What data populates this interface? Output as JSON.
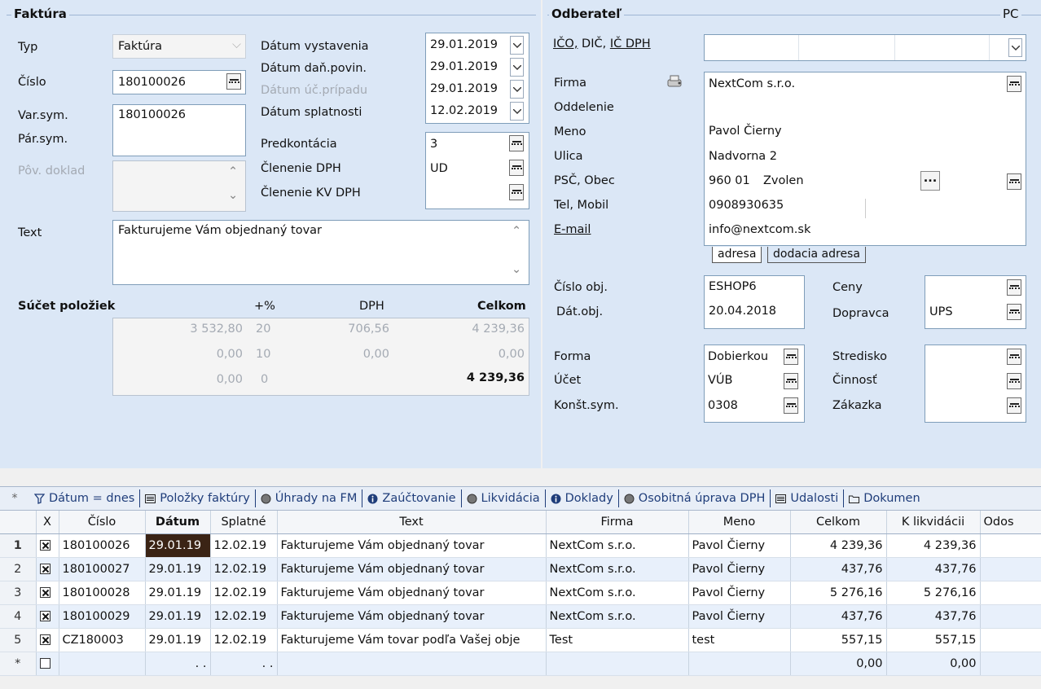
{
  "faktura": {
    "section_title": "Faktúra",
    "typ_label": "Typ",
    "typ_value": "Faktúra",
    "cislo_label": "Číslo",
    "cislo_value": "180100026",
    "varsym_label": "Var.sym.",
    "varsym_value": "180100026",
    "parsym_label": "Pár.sym.",
    "povdoklad_label": "Pôv. doklad",
    "text_label": "Text",
    "text_value": "Fakturujeme Vám objednaný tovar",
    "dates": [
      {
        "label": "Dátum vystavenia",
        "value": "29.01.2019"
      },
      {
        "label": "Dátum daň.povin.",
        "value": "29.01.2019"
      },
      {
        "label": "Dátum úč.prípadu",
        "value": "29.01.2019"
      },
      {
        "label": "Dátum splatnosti",
        "value": "12.02.2019"
      }
    ],
    "predkontacia_label": "Predkontácia",
    "predkontacia_value": "3",
    "clenenie_dph_label": "Členenie DPH",
    "clenenie_dph_value": "UD",
    "clenenie_kv_label": "Členenie KV DPH",
    "sucet": {
      "title": "Súčet položiek",
      "col_pct": "+%",
      "col_dph": "DPH",
      "col_celkom": "Celkom",
      "rows": [
        {
          "base": "3 532,80",
          "pct": "20",
          "dph": "706,56",
          "celkom": "4 239,36"
        },
        {
          "base": "0,00",
          "pct": "10",
          "dph": "0,00",
          "celkom": "0,00"
        },
        {
          "base": "0,00",
          "pct": "0",
          "dph": "",
          "celkom": "4 239,36"
        }
      ]
    }
  },
  "odberatel": {
    "section_title": "Odberateľ",
    "pc_label": "PC",
    "ico_label": "IČO,",
    "dic_label": "DIČ,",
    "icdph_label": "IČ DPH",
    "firma_label": "Firma",
    "firma_value": "NextCom s.r.o.",
    "oddelenie_label": "Oddelenie",
    "meno_label": "Meno",
    "meno_value": "Pavol Čierny",
    "ulica_label": "Ulica",
    "ulica_value": "Nadvorna 2",
    "psc_label": "PSČ, Obec",
    "psc_value": "960 01",
    "obec_value": "Zvolen",
    "tel_label": "Tel, Mobil",
    "tel_value": "0908930635",
    "email_label": "E-mail",
    "email_value": "info@nextcom.sk",
    "tab_adresa": "adresa",
    "tab_dodacia": "dodacia adresa",
    "cislo_obj_label": "Číslo obj.",
    "cislo_obj_value": "ESHOP6",
    "dat_obj_label": "Dát.obj.",
    "dat_obj_value": "20.04.2018",
    "ceny_label": "Ceny",
    "dopravca_label": "Dopravca",
    "dopravca_value": "UPS",
    "forma_label": "Forma",
    "forma_value": "Dobierkou",
    "ucet_label": "Účet",
    "ucet_value": "VÚB",
    "konst_label": "Konšt.sym.",
    "konst_value": "0308",
    "stredisko_label": "Stredisko",
    "cinnost_label": "Činnosť",
    "zakazka_label": "Zákazka"
  },
  "tabs": [
    {
      "label": "Dátum = dnes",
      "icon": "filter-icon"
    },
    {
      "label": "Položky faktúry",
      "icon": "list-icon"
    },
    {
      "label": "Úhrady na FM",
      "icon": "circle-icon"
    },
    {
      "label": "Zaúčtovanie",
      "icon": "info-icon"
    },
    {
      "label": "Likvidácia",
      "icon": "circle-icon"
    },
    {
      "label": "Doklady",
      "icon": "info-icon"
    },
    {
      "label": "Osobitná úprava DPH",
      "icon": "circle-icon"
    },
    {
      "label": "Udalosti",
      "icon": "list-icon"
    },
    {
      "label": "Dokumen",
      "icon": "folder-icon"
    }
  ],
  "grid": {
    "columns": [
      "X",
      "Číslo",
      "Dátum",
      "Splatné",
      "Text",
      "Firma",
      "Meno",
      "Celkom",
      "K likvidácii",
      "Odos"
    ],
    "rows": [
      {
        "n": "1",
        "cislo": "180100026",
        "datum": "29.01.19",
        "splatne": "12.02.19",
        "text": "Fakturujeme Vám objednaný tovar",
        "firma": "NextCom s.r.o.",
        "meno": "Pavol Čierny",
        "celkom": "4 239,36",
        "klikv": "4 239,36"
      },
      {
        "n": "2",
        "cislo": "180100027",
        "datum": "29.01.19",
        "splatne": "12.02.19",
        "text": "Fakturujeme Vám objednaný tovar",
        "firma": "NextCom s.r.o.",
        "meno": "Pavol Čierny",
        "celkom": "437,76",
        "klikv": "437,76"
      },
      {
        "n": "3",
        "cislo": "180100028",
        "datum": "29.01.19",
        "splatne": "12.02.19",
        "text": "Fakturujeme Vám objednaný tovar",
        "firma": "NextCom s.r.o.",
        "meno": "Pavol Čierny",
        "celkom": "5 276,16",
        "klikv": "5 276,16"
      },
      {
        "n": "4",
        "cislo": "180100029",
        "datum": "29.01.19",
        "splatne": "12.02.19",
        "text": "Fakturujeme Vám objednaný tovar",
        "firma": "NextCom s.r.o.",
        "meno": "Pavol Čierny",
        "celkom": "437,76",
        "klikv": "437,76"
      },
      {
        "n": "5",
        "cislo": "CZ180003",
        "datum": "29.01.19",
        "splatne": "12.02.19",
        "text": "Fakturujeme Vám tovar podľa Vašej obje",
        "firma": "Test",
        "meno": "test",
        "celkom": "557,15",
        "klikv": "557,15"
      }
    ],
    "new_row": {
      "n": "*",
      "datum": ". .",
      "splatne": ". .",
      "celkom": "0,00",
      "klikv": "0,00"
    }
  }
}
